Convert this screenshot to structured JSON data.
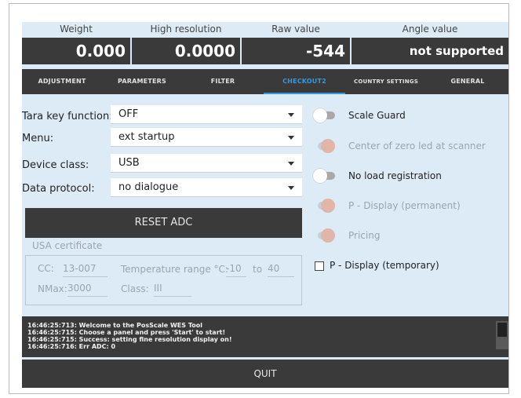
{
  "readouts": {
    "labels": [
      "Weight",
      "High resolution",
      "Raw value",
      "Angle value"
    ],
    "values": [
      "0.000",
      "0.0000",
      "-544",
      "not supported"
    ]
  },
  "tabs": [
    "ADJUSTMENT",
    "PARAMETERS",
    "FILTER",
    "CHECKOUT2",
    "COUNTRY SETTINGS",
    "GENERAL"
  ],
  "active_tab": "CHECKOUT2",
  "form": {
    "tara_label": "Tara key function:",
    "tara_value": "OFF",
    "menu_label": "Menu:",
    "menu_value": "ext startup",
    "device_label": "Device class:",
    "device_value": "USB",
    "protocol_label": "Data protocol:",
    "protocol_value": "no dialogue"
  },
  "reset_button": "RESET ADC",
  "certificate": {
    "title": "USA certificate",
    "cc_label": "CC:",
    "cc_value": "13-007",
    "temp_label": "Temperature range °C:",
    "temp_from": "-10",
    "temp_to_label": "to",
    "temp_to": "40",
    "nmax_label": "NMax:",
    "nmax_value": "3000",
    "class_label": "Class:",
    "class_value": "III"
  },
  "toggles": [
    {
      "label": "Scale Guard",
      "state": "off",
      "enabled": true
    },
    {
      "label": "Center of zero led at scanner",
      "state": "on",
      "enabled": false
    },
    {
      "label": "No load registration",
      "state": "off",
      "enabled": true
    },
    {
      "label": "P - Display (permanent)",
      "state": "on",
      "enabled": false
    },
    {
      "label": "Pricing",
      "state": "on",
      "enabled": false
    }
  ],
  "checkbox": {
    "label": "P - Display (temporary)",
    "checked": false
  },
  "log": [
    "16:46:25:713: Welcome to the PosScale WES Tool",
    "16:46:25:715: Choose a panel and press 'Start' to start!",
    "16:46:25:715: Success: setting fine resolution display on!",
    "16:46:25:716: Err ADC: 0"
  ],
  "quit_button": "QUIT",
  "colors": {
    "panel_bg": "#dcebf5",
    "dark": "#3a3a3a",
    "accent": "#3399dd",
    "disabled_knob": "#e0b6a8"
  }
}
